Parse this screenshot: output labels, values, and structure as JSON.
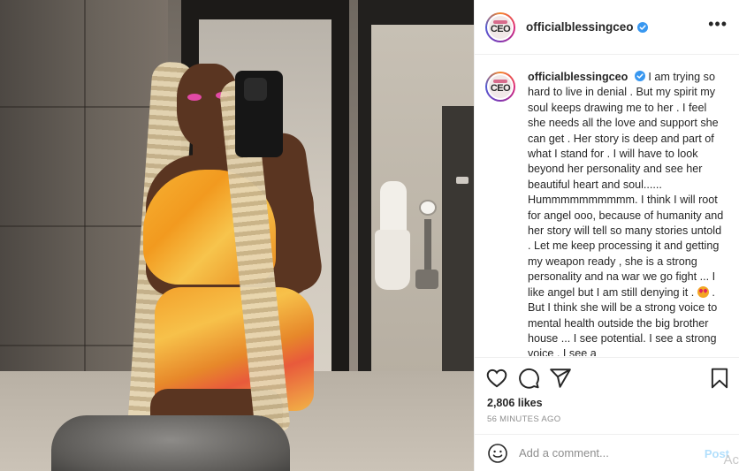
{
  "post": {
    "username": "officialblessingceo",
    "avatar_text": "CEO",
    "caption_text": "I am trying so hard to live in denial . But my spirit my soul keeps drawing me to her . I feel she needs all the love and support she can get . Her story is deep and part of what I stand for . I will have to look beyond her personality and see her beautiful heart and soul...... Hummmmmmmmmm. I think I will root for angel ooo, because of humanity and her story will tell so many stories untold . Let me keep processing it and getting my weapon ready , she is a strong personality and na war we go fight ... I like angel but I am still denying it .",
    "caption_text_2": ". But I think she will be a strong voice to mental health outside the big brother house ... I see potential. I see a strong voice . I see a",
    "likes": "2,806 likes",
    "time": "56 MINUTES AGO"
  },
  "comment_box": {
    "placeholder": "Add a comment...",
    "post_label": "Post"
  },
  "watermark": "Ac",
  "colors": {
    "verified": "#3897f0",
    "post_button": "#b2dffc",
    "muted": "#8e8e8e"
  },
  "icons": [
    "heart-icon",
    "comment-icon",
    "share-icon",
    "bookmark-icon",
    "more-options-icon",
    "emoji-icon",
    "verified-icon",
    "heart-eyes-emoji"
  ]
}
